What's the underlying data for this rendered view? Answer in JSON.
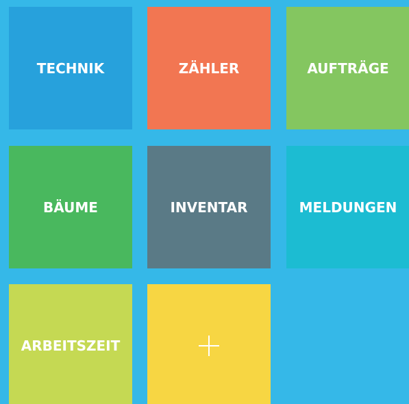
{
  "background_color": "#35b8e8",
  "tiles": [
    {
      "label": "TECHNIK",
      "color": "#27a1dc"
    },
    {
      "label": "ZÄHLER",
      "color": "#f27652"
    },
    {
      "label": "AUFTRÄGE",
      "color": "#84c660"
    },
    {
      "label": "BÄUME",
      "color": "#49b85e"
    },
    {
      "label": "INVENTAR",
      "color": "#5a7a86"
    },
    {
      "label": "MELDUNGEN",
      "color": "#1cbcd2"
    },
    {
      "label": "ARBEITSZEIT",
      "color": "#c5d953"
    },
    {
      "label": "",
      "icon": "plus-icon",
      "color": "#f7d643"
    }
  ]
}
